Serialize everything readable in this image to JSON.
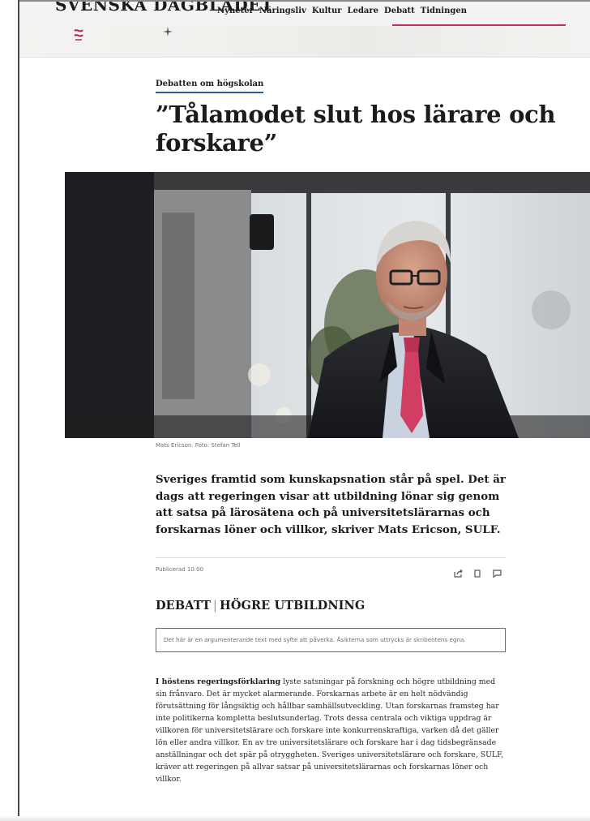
{
  "header": {
    "logo_text": "SVENSKA DAGBLADET",
    "nav": [
      "Nyheter",
      "Näringsliv",
      "Kultur",
      "Ledare",
      "Debatt",
      "Tidningen"
    ],
    "accent_color": "#c12d66"
  },
  "article": {
    "kicker": "Debatten om högskolan",
    "headline": "”Tålamodet slut hos lärare och forskare”",
    "photo_caption": "Mats Ericson. Foto: Stefan Tell",
    "lead": "Sveriges framtid som kunskapsnation står på spel. Det är dags att regeringen visar att utbildning lönar sig genom att satsa på lärosätena och på universitetslärarnas och forskarnas löner och villkor, skriver Mats Ericson, SULF.",
    "published": "Publicerad 10:00",
    "tools": [
      "share-icon",
      "bookmark-icon",
      "comment-icon"
    ],
    "section_primary": "DEBATT",
    "section_separator": "|",
    "section_secondary": "HÖGRE UTBILDNING",
    "notice": "Det här är en argumenterande text med syfte att påverka. Åsikterna som uttrycks är skribentens egna.",
    "body_lead_bold": "I höstens regeringsförklaring",
    "body_text": " lyste satsningar på forskning och högre utbildning med sin frånvaro. Det är mycket alarmerande. Forskarnas arbete är en helt nödvändig förutsättning för långsiktig och hållbar samhällsutveckling. Utan forskarnas framsteg har inte politikerna kompletta beslutsunderlag. Trots dessa centrala och viktiga uppdrag är villkoren för universitetslärare och forskare inte konkurrenskraftiga, varken då det gäller lön eller andra villkor. En av tre universitetslärare och forskare har i dag tidsbegränsade anställningar och det spär på otryggheten. Sveriges universitetslärare och forskare, SULF, kräver att regeringen på allvar satsar på universitetslärarnas och forskarnas löner och villkor.",
    "kicker_underline_color": "#2d5a9b"
  }
}
